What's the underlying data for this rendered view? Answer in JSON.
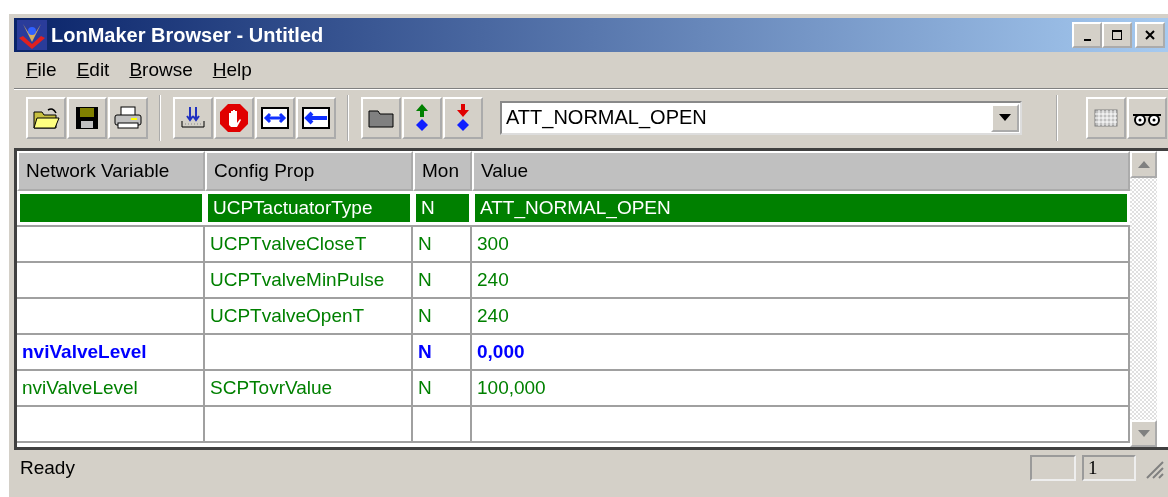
{
  "window": {
    "title": "LonMaker Browser - Untitled"
  },
  "menu": [
    {
      "label": "File"
    },
    {
      "label": "Edit"
    },
    {
      "label": "Browse"
    },
    {
      "label": "Help"
    }
  ],
  "toolbar": {
    "value_field": {
      "value": "ATT_NORMAL_OPEN"
    }
  },
  "table": {
    "columns": [
      "Network Variable",
      "Config Prop",
      "Mon",
      "Value"
    ],
    "rows": [
      {
        "kind": "config",
        "selected": true,
        "config_prop": "UCPTactuatorType",
        "mon": "N",
        "value": "ATT_NORMAL_OPEN"
      },
      {
        "kind": "config",
        "selected": false,
        "config_prop": "UCPTvalveCloseT",
        "mon": "N",
        "value": "300"
      },
      {
        "kind": "config",
        "selected": false,
        "config_prop": "UCPTvalveMinPulse",
        "mon": "N",
        "value": "240"
      },
      {
        "kind": "config",
        "selected": false,
        "config_prop": "UCPTvalveOpenT",
        "mon": "N",
        "value": "240"
      },
      {
        "kind": "variable",
        "selected": false,
        "network_variable": "nviValveLevel",
        "mon": "N",
        "value": "0,000"
      },
      {
        "kind": "config",
        "selected": false,
        "network_variable": "nviValveLevel",
        "config_prop": "SCPTovrValue",
        "mon": "N",
        "value": "100,000"
      }
    ]
  },
  "status_bar": {
    "text": "Ready",
    "pane_2": "1"
  }
}
